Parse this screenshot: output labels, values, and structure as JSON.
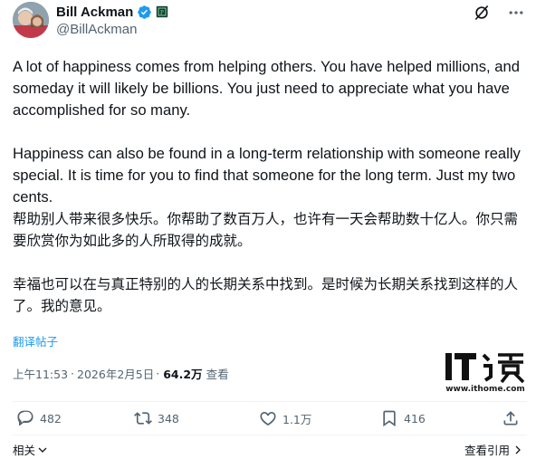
{
  "author": {
    "display_name": "Bill Ackman",
    "handle": "@BillAckman"
  },
  "tweet": {
    "en_paragraphs": [
      "A lot of happiness comes from helping others. You have helped millions, and someday it will likely be billions. You just need to appreciate what you have accomplished for so many.",
      "Happiness can also be found in a long-term relationship with someone really special. It is time for you to find that someone for the long term. Just my two cents."
    ],
    "zh_paragraphs": [
      "帮助别人带来很多快乐。你帮助了数百万人，也许有一天会帮助数十亿人。你只需要欣赏你为如此多的人所取得的成就。",
      "幸福也可以在与真正特别的人的长期关系中找到。是时候为长期关系找到这样的人了。我的意见。"
    ]
  },
  "translate_label": "翻译帖子",
  "meta": {
    "time": "上午11:53",
    "dot": "·",
    "date": "2026年2月5日",
    "views_count": "64.2万",
    "views_label": "查看"
  },
  "watermark": {
    "url": "www.ithome.com"
  },
  "actions": {
    "replies": "482",
    "reposts": "348",
    "likes": "1.1万",
    "bookmarks": "416"
  },
  "footer": {
    "related_label": "相关",
    "quotes_label": "查看引用"
  },
  "colors": {
    "accent": "#1d9bf0",
    "secondary_text": "#536471",
    "primary_text": "#0f1419",
    "verified": "#1d9bf0"
  }
}
